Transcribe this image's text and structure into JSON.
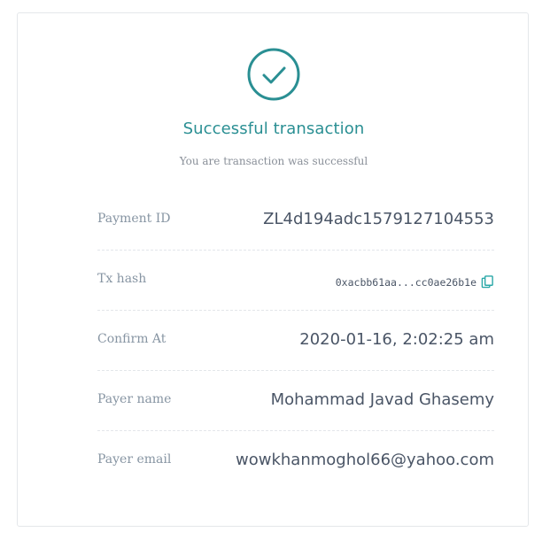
{
  "status": {
    "title": "Successful transaction",
    "subtitle": "You are transaction was successful",
    "icon": "check-circle-icon",
    "accent_color": "#2a8f93"
  },
  "details": [
    {
      "label": "Payment ID",
      "value": "ZL4d194adc1579127104553"
    },
    {
      "label": "Tx hash",
      "value": "0xacbb61aa...cc0ae26b1e",
      "action_icon": "copy-icon"
    },
    {
      "label": "Confirm At",
      "value": "2020-01-16, 2:02:25 am"
    },
    {
      "label": "Payer name",
      "value": "Mohammad Javad Ghasemy"
    },
    {
      "label": "Payer email",
      "value": "wowkhanmoghol66@yahoo.com"
    }
  ]
}
